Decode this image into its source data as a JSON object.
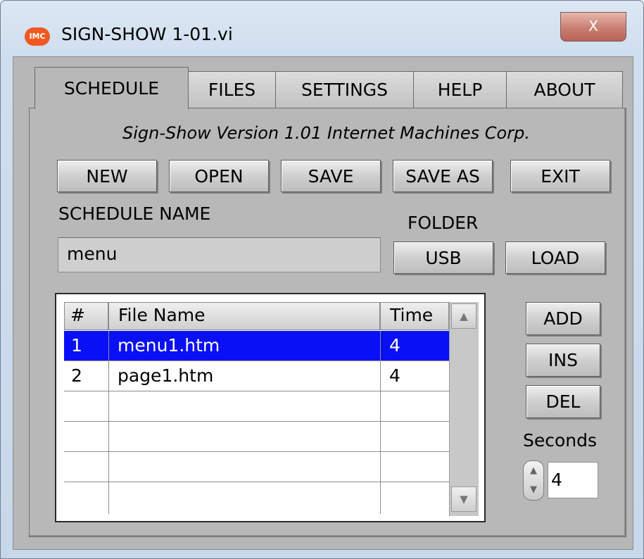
{
  "window": {
    "title": "SIGN-SHOW 1-01.vi",
    "icon_text": "IMC",
    "close_glyph": "X"
  },
  "tabs": [
    {
      "label": "SCHEDULE",
      "active": true
    },
    {
      "label": "FILES",
      "active": false
    },
    {
      "label": "SETTINGS",
      "active": false
    },
    {
      "label": "HELP",
      "active": false
    },
    {
      "label": "ABOUT",
      "active": false
    }
  ],
  "version_text": "Sign-Show Version 1.01  Internet Machines Corp.",
  "toolbar": {
    "new": "NEW",
    "open": "OPEN",
    "save": "SAVE",
    "save_as": "SAVE AS",
    "exit": "EXIT"
  },
  "schedule": {
    "name_label": "SCHEDULE NAME",
    "name_value": "menu"
  },
  "folder": {
    "label": "FOLDER",
    "usb": "USB",
    "load": "LOAD"
  },
  "table": {
    "columns": [
      "#",
      "File Name",
      "Time"
    ],
    "rows": [
      {
        "num": "1",
        "file": "menu1.htm",
        "time": "4",
        "selected": true
      },
      {
        "num": "2",
        "file": "page1.htm",
        "time": "4",
        "selected": false
      },
      {
        "num": "",
        "file": "",
        "time": ""
      },
      {
        "num": "",
        "file": "",
        "time": ""
      },
      {
        "num": "",
        "file": "",
        "time": ""
      },
      {
        "num": "",
        "file": "",
        "time": ""
      }
    ]
  },
  "actions": {
    "add": "ADD",
    "ins": "INS",
    "del": "DEL"
  },
  "seconds": {
    "label": "Seconds",
    "value": "4"
  },
  "colors": {
    "selection": "#0a10f5",
    "panel": "#b8b8b8",
    "close": "#c97f72"
  },
  "icons": {
    "up": "scroll-up-icon",
    "down": "scroll-down-icon",
    "spin_up": "spin-up-icon",
    "spin_down": "spin-down-icon"
  }
}
